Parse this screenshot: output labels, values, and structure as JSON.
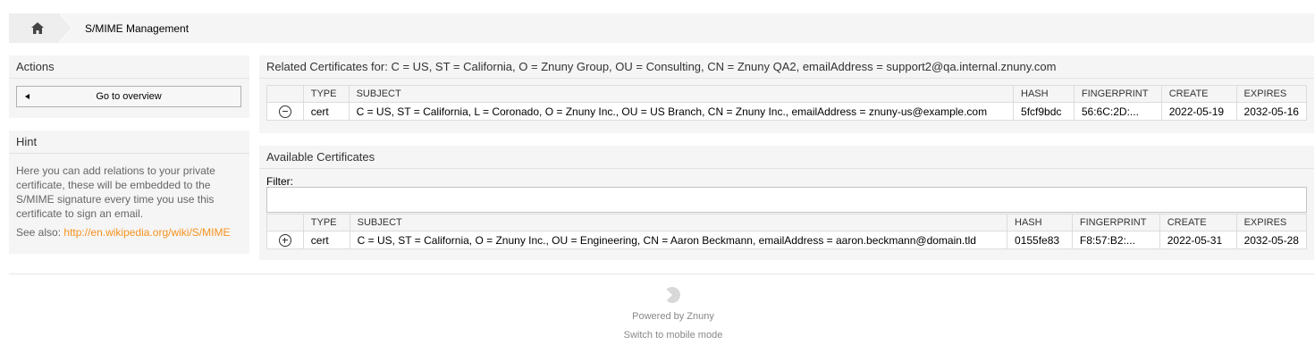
{
  "breadcrumb": {
    "home_icon": "home-icon",
    "current": "S/MIME Management"
  },
  "sidebar": {
    "actions": {
      "title": "Actions",
      "overview_button": "Go to overview"
    },
    "hint": {
      "title": "Hint",
      "text": "Here you can add relations to your private certificate, these will be embedded to the S/MIME signature every time you use this certificate to sign an email.",
      "see_also_label": "See also:",
      "see_also_link": "http://en.wikipedia.org/wiki/S/MIME"
    }
  },
  "related": {
    "title": "Related Certificates for: C = US, ST = California, O = Znuny Group, OU = Consulting, CN = Znuny QA2, emailAddress = support2@qa.internal.znuny.com",
    "columns": [
      "",
      "TYPE",
      "SUBJECT",
      "HASH",
      "FINGERPRINT",
      "CREATE",
      "EXPIRES"
    ],
    "rows": [
      {
        "action_icon": "minus-circle-icon",
        "type": "cert",
        "subject": "C = US, ST = California, L = Coronado, O = Znuny Inc., OU = US Branch, CN = Znuny Inc., emailAddress = znuny-us@example.com",
        "hash": "5fcf9bdc",
        "fingerprint": "56:6C:2D:...",
        "create": "2022-05-19",
        "expires": "2032-05-16"
      }
    ]
  },
  "available": {
    "title": "Available Certificates",
    "filter_label": "Filter:",
    "filter_value": "",
    "columns": [
      "",
      "TYPE",
      "SUBJECT",
      "HASH",
      "FINGERPRINT",
      "CREATE",
      "EXPIRES"
    ],
    "rows": [
      {
        "action_icon": "plus-circle-icon",
        "type": "cert",
        "subject": "C = US, ST = California, O = Znuny Inc., OU = Engineering, CN = Aaron Beckmann, emailAddress = aaron.beckmann@domain.tld",
        "hash": "0155fe83",
        "fingerprint": "F8:57:B2:...",
        "create": "2022-05-31",
        "expires": "2032-05-28"
      }
    ]
  },
  "footer": {
    "logo_icon": "znuny-logo-icon",
    "powered_by": "Powered by Znuny",
    "mobile_mode": "Switch to mobile mode"
  },
  "colors": {
    "link": "#f7921e",
    "widget_bg": "#f5f5f5"
  }
}
